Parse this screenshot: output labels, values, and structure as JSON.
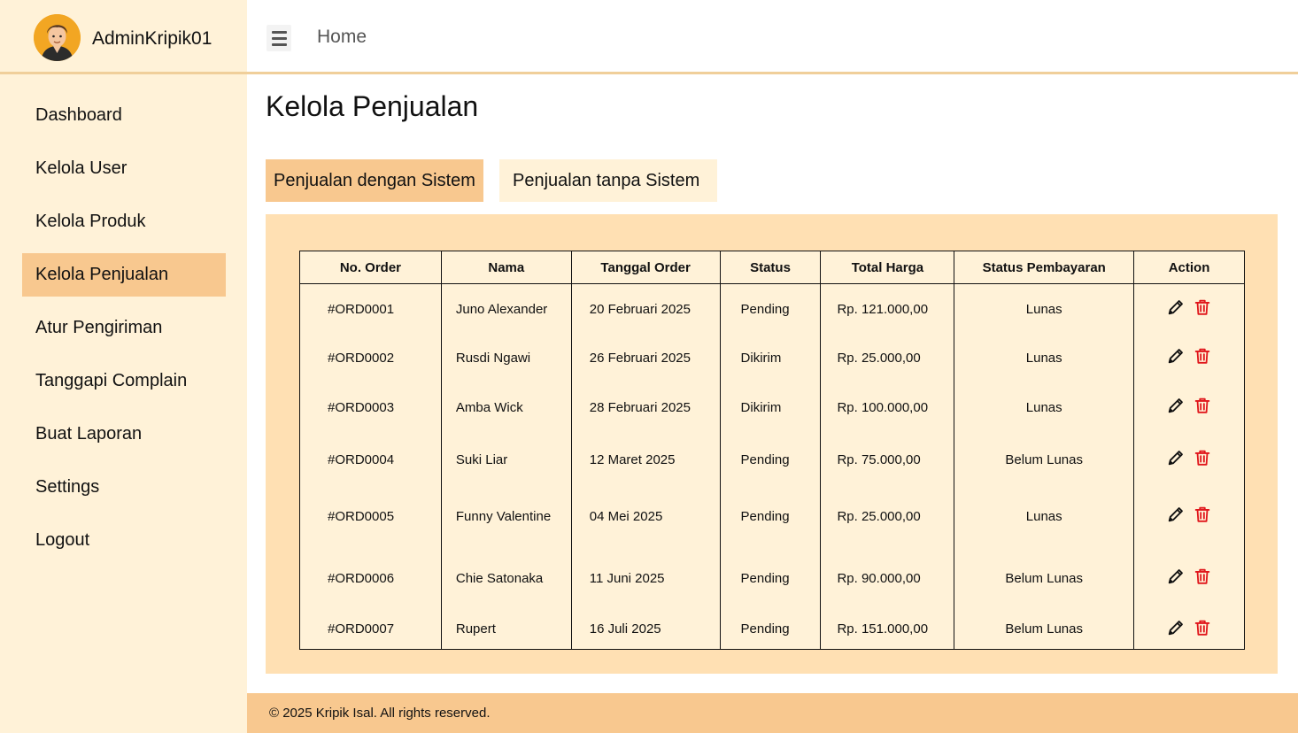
{
  "user": {
    "name": "AdminKripik01",
    "avatar_icon": "avatar-icon"
  },
  "topbar": {
    "menu_icon": "hamburger-icon",
    "breadcrumb": "Home"
  },
  "sidebar": {
    "items": [
      {
        "label": "Dashboard",
        "active": false
      },
      {
        "label": "Kelola User",
        "active": false
      },
      {
        "label": "Kelola Produk",
        "active": false
      },
      {
        "label": "Kelola Penjualan",
        "active": true
      },
      {
        "label": "Atur Pengiriman",
        "active": false
      },
      {
        "label": "Tanggapi Complain",
        "active": false
      },
      {
        "label": "Buat Laporan",
        "active": false
      },
      {
        "label": "Settings",
        "active": false
      },
      {
        "label": "Logout",
        "active": false
      }
    ]
  },
  "main": {
    "title": "Kelola Penjualan",
    "tabs": [
      {
        "label": "Penjualan dengan Sistem",
        "active": true
      },
      {
        "label": "Penjualan tanpa Sistem",
        "active": false
      }
    ]
  },
  "table": {
    "headers": [
      "No. Order",
      "Nama",
      "Tanggal Order",
      "Status",
      "Total Harga",
      "Status Pembayaran",
      "Action"
    ],
    "rows": [
      {
        "order": "#ORD0001",
        "name": "Juno Alexander",
        "date": "20 Februari 2025",
        "status": "Pending",
        "total": "Rp. 121.000,00",
        "payment": "Lunas"
      },
      {
        "order": "#ORD0002",
        "name": "Rusdi Ngawi",
        "date": "26 Februari 2025",
        "status": "Dikirim",
        "total": "Rp. 25.000,00",
        "payment": "Lunas"
      },
      {
        "order": "#ORD0003",
        "name": "Amba Wick",
        "date": "28 Februari 2025",
        "status": "Dikirim",
        "total": "Rp. 100.000,00",
        "payment": "Lunas"
      },
      {
        "order": "#ORD0004",
        "name": "Suki Liar",
        "date": "12 Maret 2025",
        "status": "Pending",
        "total": "Rp. 75.000,00",
        "payment": "Belum Lunas"
      },
      {
        "order": "#ORD0005",
        "name": "Funny Valentine",
        "date": "04 Mei 2025",
        "status": "Pending",
        "total": "Rp. 25.000,00",
        "payment": "Lunas"
      },
      {
        "order": "#ORD0006",
        "name": "Chie Satonaka",
        "date": "11 Juni 2025",
        "status": "Pending",
        "total": "Rp. 90.000,00",
        "payment": "Belum Lunas"
      },
      {
        "order": "#ORD0007",
        "name": "Rupert",
        "date": "16 Juli 2025",
        "status": "Pending",
        "total": "Rp. 151.000,00",
        "payment": "Belum Lunas"
      }
    ],
    "action_icons": [
      "pencil-icon",
      "trash-icon"
    ]
  },
  "footer": {
    "text": "© 2025 Kripik Isal. All rights reserved."
  },
  "colors": {
    "sidebar_bg": "#fff2d8",
    "accent": "#f8c88f",
    "panel_bg": "#ffe0b3",
    "divider": "#f0cf9a",
    "delete_red": "#e0161b"
  }
}
